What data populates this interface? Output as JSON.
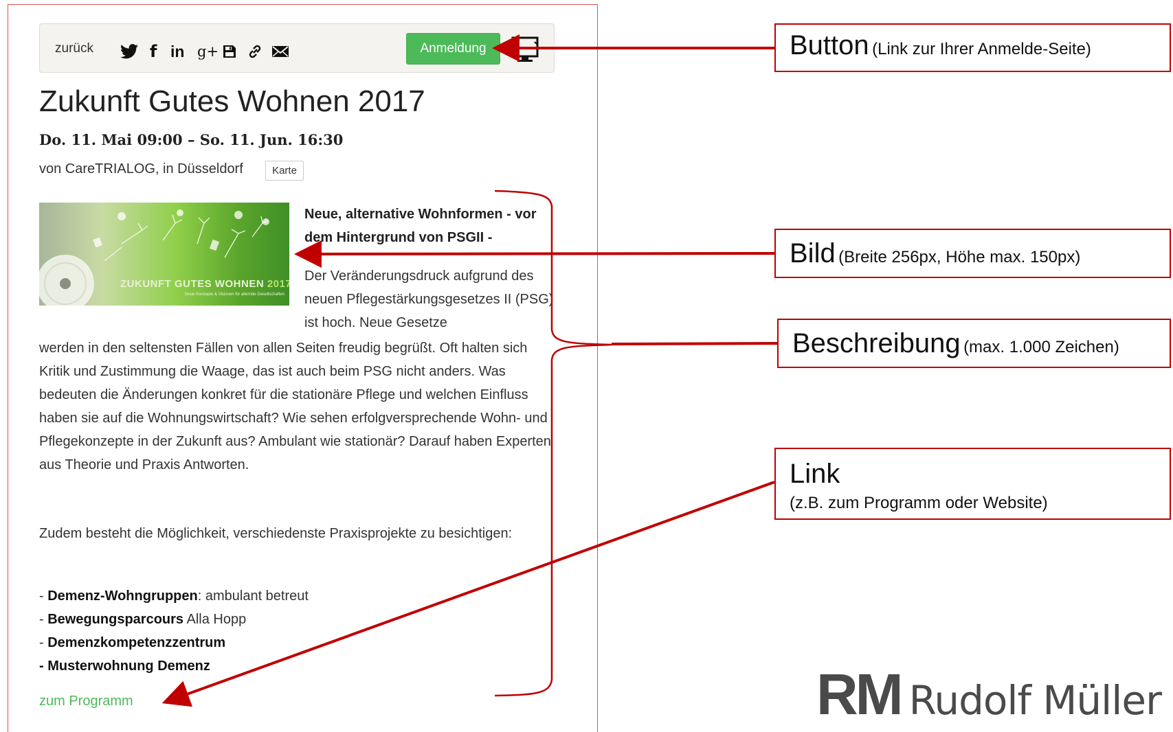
{
  "toolbar": {
    "back_label": "zurück",
    "share_icons": [
      "twitter-icon",
      "facebook-icon",
      "linkedin-icon",
      "google-plus-icon",
      "save-icon",
      "link-icon",
      "mail-icon"
    ],
    "twitter_glyph": "🐦",
    "facebook_glyph": "f",
    "linkedin_glyph": "in",
    "googleplus_glyph": "g+",
    "register_label": "Anmeldung"
  },
  "event": {
    "title": "Zukunft Gutes Wohnen 2017",
    "date": "Do. 11. Mai 09:00 – So. 11. Jun. 16:30",
    "organizer": "von CareTRIALOG, in Düsseldorf",
    "map_label": "Karte",
    "image": {
      "caption_a": "ZUKUNFT ",
      "caption_b": "GUTES WOHNEN ",
      "caption_year": "2017",
      "caption_sub": "Neue Konzepte & Visionen für alternde Gesellschaften"
    },
    "desc_heading": "Neue, alternative Wohnformen - vor dem Hintergrund von PSGII -",
    "desc_wrap": "Der Veränderungsdruck aufgrund des neuen Pflegestärkungsgesetzes II (PSG) ist hoch. Neue Gesetze",
    "desc_body": "werden in den seltensten Fällen von allen Seiten freudig begrüßt. Oft halten sich Kritik und Zustimmung die Waage, das ist auch beim PSG nicht anders. Was bedeuten die Änderungen konkret für die stationäre Pflege und welchen Einfluss haben sie auf die Wohnungswirtschaft? Wie sehen erfolgversprechende Wohn- und Pflegekonzepte in der Zukunft aus? Ambulant wie stationär? Darauf haben Experten aus Theorie und Praxis Antworten.",
    "desc_para2": "Zudem besteht die Möglichkeit, verschiedenste Praxisprojekte zu besichtigen:",
    "list": [
      {
        "prefix": "- ",
        "bold": "Demenz-Wohngruppen",
        "rest": ": ambulant betreut"
      },
      {
        "prefix": "- ",
        "bold": "Bewegungsparcours",
        "rest": " Alla Hopp"
      },
      {
        "prefix": "- ",
        "bold": "Demenzkompetenzzentrum",
        "rest": ""
      },
      {
        "prefix": "",
        "bold": "- Musterwohnung Demenz",
        "rest": ""
      }
    ],
    "program_link": "zum Programm"
  },
  "callouts": {
    "button": {
      "title": "Button",
      "note": "(Link zur Ihrer Anmelde-Seite)"
    },
    "bild": {
      "title": "Bild",
      "note": "(Breite 256px, Höhe max. 150px)"
    },
    "beschreibung": {
      "title": "Beschreibung",
      "note": "(max. 1.000 Zeichen)"
    },
    "link": {
      "title": "Link",
      "note": "(z.B. zum Programm oder Website)"
    }
  },
  "logo": {
    "mark": "RM",
    "name": "Rudolf Müller"
  },
  "colors": {
    "accent_green": "#4cba59",
    "callout_red": "#c00000",
    "frame_red": "#d9534f"
  }
}
